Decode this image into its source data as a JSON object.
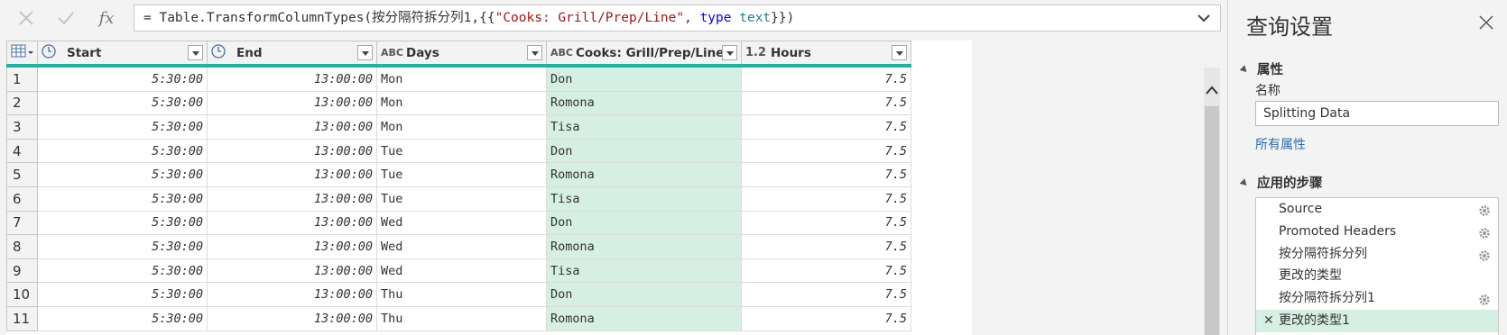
{
  "formula": {
    "prefix": "= Table.TransformColumnTypes(按分隔符拆分列1,{{",
    "str": "\"Cooks: Grill/Prep/Line\"",
    "comma": ", ",
    "kw": "type",
    "space": " ",
    "typename": "text",
    "suffix": "}})"
  },
  "columns": [
    {
      "name": "Start",
      "icon": "clock-icon"
    },
    {
      "name": "End",
      "icon": "clock-icon"
    },
    {
      "name": "Days",
      "icon": "ABC"
    },
    {
      "name": "Cooks: Grill/Prep/Line",
      "icon": "ABC"
    },
    {
      "name": "Hours",
      "icon": "1.2"
    }
  ],
  "rows": [
    {
      "n": "1",
      "start": "5:30:00",
      "end": "13:00:00",
      "day": "Mon",
      "cook": "Don",
      "hours": "7.5"
    },
    {
      "n": "2",
      "start": "5:30:00",
      "end": "13:00:00",
      "day": "Mon",
      "cook": "Romona",
      "hours": "7.5"
    },
    {
      "n": "3",
      "start": "5:30:00",
      "end": "13:00:00",
      "day": "Mon",
      "cook": "Tisa",
      "hours": "7.5"
    },
    {
      "n": "4",
      "start": "5:30:00",
      "end": "13:00:00",
      "day": "Tue",
      "cook": "Don",
      "hours": "7.5"
    },
    {
      "n": "5",
      "start": "5:30:00",
      "end": "13:00:00",
      "day": "Tue",
      "cook": "Romona",
      "hours": "7.5"
    },
    {
      "n": "6",
      "start": "5:30:00",
      "end": "13:00:00",
      "day": "Tue",
      "cook": "Tisa",
      "hours": "7.5"
    },
    {
      "n": "7",
      "start": "5:30:00",
      "end": "13:00:00",
      "day": "Wed",
      "cook": "Don",
      "hours": "7.5"
    },
    {
      "n": "8",
      "start": "5:30:00",
      "end": "13:00:00",
      "day": "Wed",
      "cook": "Romona",
      "hours": "7.5"
    },
    {
      "n": "9",
      "start": "5:30:00",
      "end": "13:00:00",
      "day": "Wed",
      "cook": "Tisa",
      "hours": "7.5"
    },
    {
      "n": "10",
      "start": "5:30:00",
      "end": "13:00:00",
      "day": "Thu",
      "cook": "Don",
      "hours": "7.5"
    },
    {
      "n": "11",
      "start": "5:30:00",
      "end": "13:00:00",
      "day": "Thu",
      "cook": "Romona",
      "hours": "7.5"
    }
  ],
  "settings": {
    "title": "查询设置",
    "properties_label": "属性",
    "name_label": "名称",
    "name_value": "Splitting Data",
    "all_properties": "所有属性",
    "applied_steps_label": "应用的步骤",
    "steps": [
      {
        "label": "Source",
        "gear": true
      },
      {
        "label": "Promoted Headers",
        "gear": true
      },
      {
        "label": "按分隔符拆分列",
        "gear": true
      },
      {
        "label": "更改的类型",
        "gear": false
      },
      {
        "label": "按分隔符拆分列1",
        "gear": true
      },
      {
        "label": "更改的类型1",
        "gear": false,
        "active": true
      }
    ]
  },
  "colors": {
    "accent": "#1fb3a3",
    "selected_column": "#d6efe3",
    "link": "#2e6bb0"
  }
}
